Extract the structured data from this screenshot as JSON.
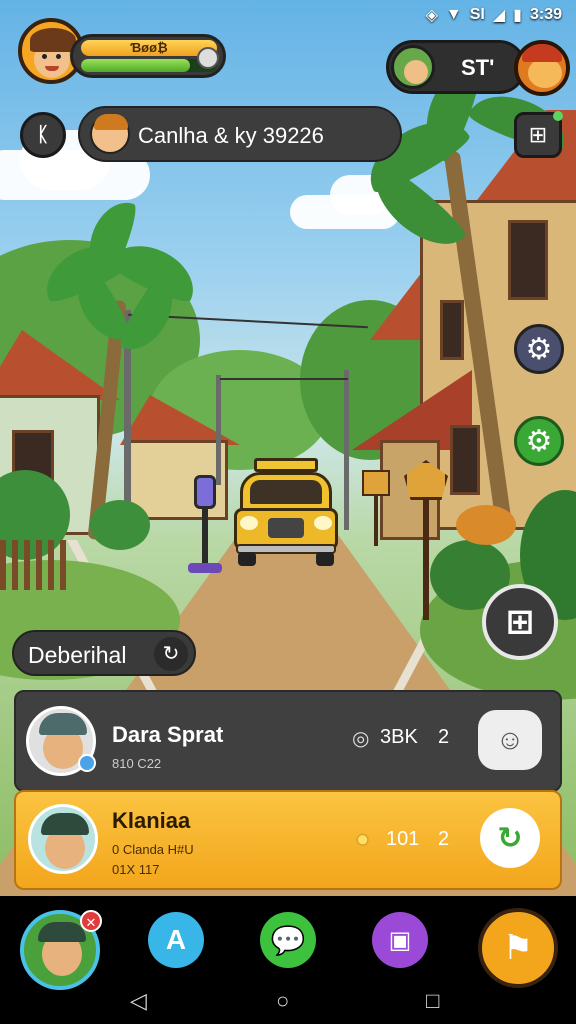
{
  "status_bar": {
    "time": "3:39",
    "signal_label": "SI"
  },
  "hud": {
    "level_label": "Ɓøø₿",
    "xp_fraction": 0.8,
    "coins_label": "ST'",
    "quest_banner": "Canlha & ky 39226"
  },
  "side_buttons": {
    "map_icon": "map-icon",
    "settings_icon": "gear-icon",
    "settings_green_icon": "gear-icon",
    "action_icon": "hash-icon"
  },
  "location_pill": {
    "label": "Deberihal"
  },
  "players": [
    {
      "name": "Dara Sprat",
      "sub": "810 C22",
      "stat": "3BK",
      "rank": "2",
      "stat_icon": "camera-icon",
      "action_icon": "ghost-icon"
    },
    {
      "name": "Klaniaa",
      "sub_line1": "0 Clanda H#U",
      "sub_line2": "01X 117",
      "stat": "101",
      "rank": "2",
      "stat_icon": "coin-icon",
      "action_icon": "refresh-icon"
    }
  ],
  "bottom_nav": {
    "items": [
      "profile-icon",
      "chat-a-icon",
      "message-icon",
      "shop-icon",
      "event-icon"
    ]
  },
  "colors": {
    "gold": "#f5a623",
    "dark_panel": "#3b3b3b",
    "green": "#3aa835"
  }
}
